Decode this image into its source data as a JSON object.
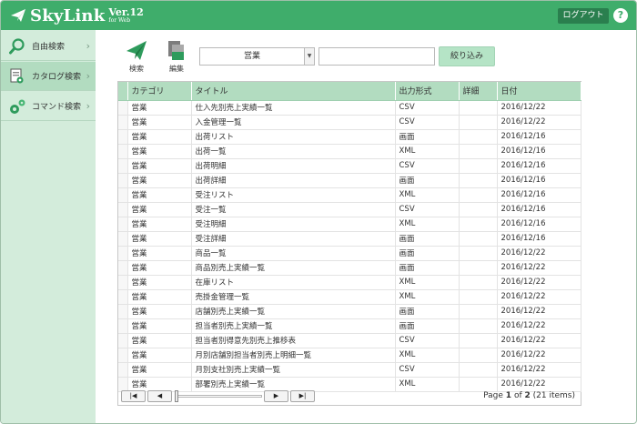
{
  "header": {
    "logo_text": "SkyLink",
    "version": "Ver.12",
    "edition": "for Web",
    "logout_label": "ログアウト",
    "help_label": "?"
  },
  "sidebar": {
    "items": [
      {
        "label": "自由検索",
        "icon": "magnifier-icon"
      },
      {
        "label": "カタログ検索",
        "icon": "catalog-icon"
      },
      {
        "label": "コマンド検索",
        "icon": "command-gear-icon"
      }
    ]
  },
  "toolbar": {
    "search_label": "検索",
    "edit_label": "編集",
    "category_value": "営業",
    "search_text": "",
    "filter_label": "絞り込み"
  },
  "colors": {
    "brand_green": "#3fad6b",
    "header_row": "#b2dcc0",
    "sidebar_bg": "#d3ecdb"
  },
  "table": {
    "columns": [
      "カテゴリ",
      "タイトル",
      "出力形式",
      "詳細",
      "日付"
    ],
    "rows": [
      [
        "営業",
        "仕入先別売上実績一覧",
        "CSV",
        "",
        "2016/12/22"
      ],
      [
        "営業",
        "入金管理一覧",
        "CSV",
        "",
        "2016/12/22"
      ],
      [
        "営業",
        "出荷リスト",
        "画面",
        "",
        "2016/12/16"
      ],
      [
        "営業",
        "出荷一覧",
        "XML",
        "",
        "2016/12/16"
      ],
      [
        "営業",
        "出荷明細",
        "CSV",
        "",
        "2016/12/16"
      ],
      [
        "営業",
        "出荷詳細",
        "画面",
        "",
        "2016/12/16"
      ],
      [
        "営業",
        "受注リスト",
        "XML",
        "",
        "2016/12/16"
      ],
      [
        "営業",
        "受注一覧",
        "CSV",
        "",
        "2016/12/16"
      ],
      [
        "営業",
        "受注明細",
        "XML",
        "",
        "2016/12/16"
      ],
      [
        "営業",
        "受注詳細",
        "画面",
        "",
        "2016/12/16"
      ],
      [
        "営業",
        "商品一覧",
        "画面",
        "",
        "2016/12/22"
      ],
      [
        "営業",
        "商品別売上実績一覧",
        "画面",
        "",
        "2016/12/22"
      ],
      [
        "営業",
        "在庫リスト",
        "XML",
        "",
        "2016/12/22"
      ],
      [
        "営業",
        "売掛金管理一覧",
        "XML",
        "",
        "2016/12/22"
      ],
      [
        "営業",
        "店舗別売上実績一覧",
        "画面",
        "",
        "2016/12/22"
      ],
      [
        "営業",
        "担当者別売上実績一覧",
        "画面",
        "",
        "2016/12/22"
      ],
      [
        "営業",
        "担当者別得意先別売上推移表",
        "CSV",
        "",
        "2016/12/22"
      ],
      [
        "営業",
        "月別店舗別担当者別売上明細一覧",
        "XML",
        "",
        "2016/12/22"
      ],
      [
        "営業",
        "月別支社別売上実績一覧",
        "CSV",
        "",
        "2016/12/22"
      ],
      [
        "営業",
        "部署別売上実績一覧",
        "XML",
        "",
        "2016/12/22"
      ]
    ]
  },
  "pager": {
    "first": "|◀",
    "prev": "◀",
    "next": "▶",
    "last": "▶|",
    "page_word": "Page",
    "current": "1",
    "of_word": "of",
    "total_pages": "2",
    "items_text": "(21 items)"
  }
}
